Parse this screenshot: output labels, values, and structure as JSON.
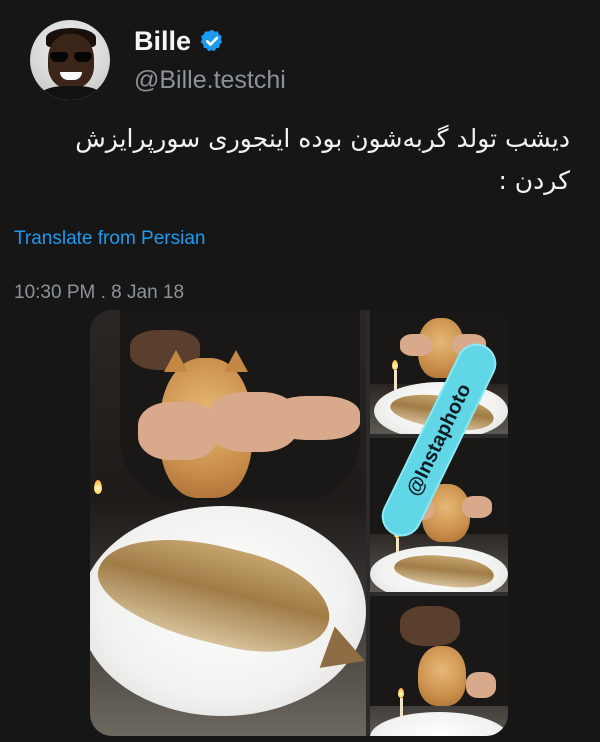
{
  "author": {
    "display_name": "Bille",
    "handle": "@Bille.testchi",
    "verified_color": "#1d9bf0"
  },
  "tweet": {
    "text_line_1": "دیشب تولد گربه‌شون بوده اینجوری سورپرایزش",
    "text_line_2": "کردن :",
    "translate_label": "Translate from Persian",
    "timestamp": "10:30 PM . 8 Jan 18"
  },
  "media": {
    "watermark_text": "@Instaphoto"
  },
  "colors": {
    "background": "#161617",
    "link": "#1d9bf0",
    "muted": "#8b9299"
  }
}
